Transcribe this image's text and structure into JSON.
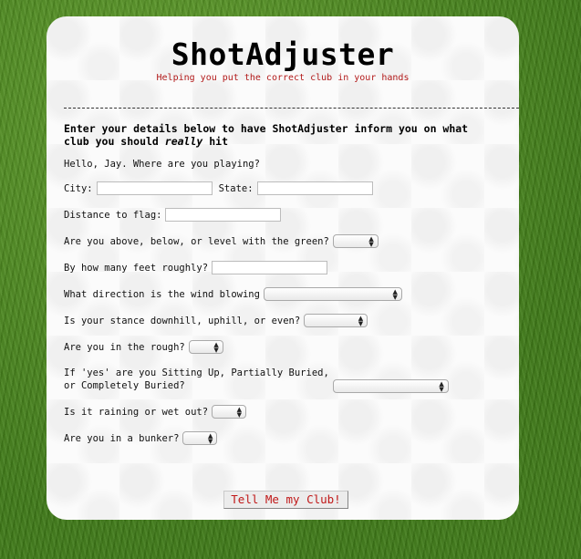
{
  "app": {
    "title": "ShotAdjuster",
    "subtitle": "Helping you put the correct club in your hands"
  },
  "intro": {
    "line1": "Enter your details below to have ShotAdjuster inform you on what",
    "line2_prefix": "club you should ",
    "line2_emph": "really",
    "line2_suffix": " hit"
  },
  "form": {
    "greeting": "Hello, Jay. Where are you playing?",
    "city_label": "City:",
    "city_value": "",
    "state_label": "State:",
    "state_value": "",
    "distance_label": "Distance to flag:",
    "distance_value": "",
    "elevation_label": "Are you above, below, or level with the green?",
    "elevation_value": "",
    "feet_label": "By how many feet roughly?",
    "feet_value": "",
    "wind_label": "What direction is the wind blowing",
    "wind_value": "",
    "stance_label": "Is your stance downhill, uphill, or even?",
    "stance_value": "",
    "rough_label": "Are you in the rough?",
    "rough_value": "",
    "lie_label_line1": "If 'yes' are you Sitting Up, Partially Buried,",
    "lie_label_line2": "or Completely Buried?",
    "lie_value": "",
    "rain_label": "Is it raining or wet out?",
    "rain_value": "",
    "bunker_label": "Are you in a bunker?",
    "bunker_value": "",
    "submit_label": "Tell Me my Club!"
  },
  "colors": {
    "subtitle": "#b21a1a",
    "submit_text": "#c01818",
    "grass": "#4f8a22"
  },
  "icons": {
    "select_arrow": "updown-arrows-icon"
  }
}
